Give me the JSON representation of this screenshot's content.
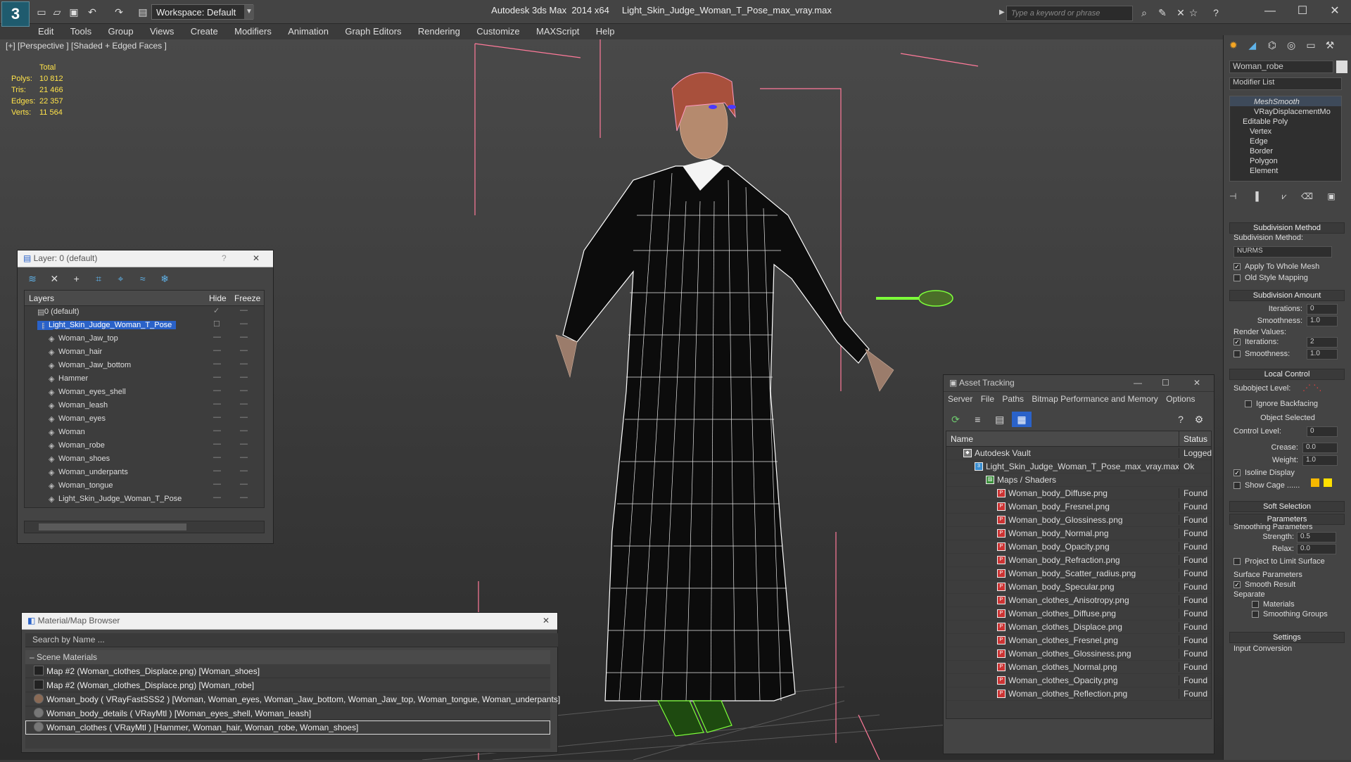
{
  "app": {
    "title": "Autodesk 3ds Max  2014 x64     Light_Skin_Judge_Woman_T_Pose_max_vray.max",
    "workspace": "Workspace: Default",
    "search_placeholder": "Type a keyword or phrase",
    "logo": "3"
  },
  "menus": [
    "Edit",
    "Tools",
    "Group",
    "Views",
    "Create",
    "Modifiers",
    "Animation",
    "Graph Editors",
    "Rendering",
    "Customize",
    "MAXScript",
    "Help"
  ],
  "viewport": {
    "label": "[+] [Perspective ] [Shaded + Edged Faces ]",
    "stats": {
      "header": "Total",
      "polys_label": "Polys:",
      "polys": "10 812",
      "tris_label": "Tris:",
      "tris": "21 466",
      "edges_label": "Edges:",
      "edges": "22 357",
      "verts_label": "Verts:",
      "verts": "11 564"
    }
  },
  "layer_panel": {
    "title": "Layer: 0 (default)",
    "help": "?",
    "close": "✕",
    "col_layers": "Layers",
    "col_hide": "Hide",
    "col_freeze": "Freeze",
    "rows": [
      {
        "name": "0 (default)",
        "indent": 1
      },
      {
        "name": "Light_Skin_Judge_Woman_T_Pose",
        "indent": 1,
        "selected": true
      },
      {
        "name": "Woman_Jaw_top",
        "indent": 2
      },
      {
        "name": "Woman_hair",
        "indent": 2
      },
      {
        "name": "Woman_Jaw_bottom",
        "indent": 2
      },
      {
        "name": "Hammer",
        "indent": 2
      },
      {
        "name": "Woman_eyes_shell",
        "indent": 2
      },
      {
        "name": "Woman_leash",
        "indent": 2
      },
      {
        "name": "Woman_eyes",
        "indent": 2
      },
      {
        "name": "Woman",
        "indent": 2
      },
      {
        "name": "Woman_robe",
        "indent": 2
      },
      {
        "name": "Woman_shoes",
        "indent": 2
      },
      {
        "name": "Woman_underpants",
        "indent": 2
      },
      {
        "name": "Woman_tongue",
        "indent": 2
      },
      {
        "name": "Light_Skin_Judge_Woman_T_Pose",
        "indent": 2
      }
    ]
  },
  "material_browser": {
    "title": "Material/Map Browser",
    "close": "✕",
    "search_placeholder": "Search by Name ...",
    "group": "Scene Materials",
    "rows": [
      "Map #2 (Woman_clothes_Displace.png) [Woman_shoes]",
      "Map #2 (Woman_clothes_Displace.png) [Woman_robe]",
      "Woman_body  ( VRayFastSSS2 ) [Woman, Woman_eyes, Woman_Jaw_bottom, Woman_Jaw_top, Woman_tongue, Woman_underpants]",
      "Woman_body_details  ( VRayMtl ) [Woman_eyes_shell, Woman_leash]",
      "Woman_clothes  ( VRayMtl ) [Hammer, Woman_hair, Woman_robe, Woman_shoes]"
    ]
  },
  "asset_tracking": {
    "title": "Asset Tracking",
    "menu": [
      "Server",
      "File",
      "Paths",
      "Bitmap Performance and Memory",
      "Options"
    ],
    "col_name": "Name",
    "col_status": "Status",
    "rows": [
      {
        "name": "Autodesk Vault",
        "status": "Logged O",
        "indent": 0
      },
      {
        "name": "Light_Skin_Judge_Woman_T_Pose_max_vray.max",
        "status": "Ok",
        "indent": 1
      },
      {
        "name": "Maps / Shaders",
        "status": "",
        "indent": 2
      },
      {
        "name": "Woman_body_Diffuse.png",
        "status": "Found",
        "indent": 3
      },
      {
        "name": "Woman_body_Fresnel.png",
        "status": "Found",
        "indent": 3
      },
      {
        "name": "Woman_body_Glossiness.png",
        "status": "Found",
        "indent": 3
      },
      {
        "name": "Woman_body_Normal.png",
        "status": "Found",
        "indent": 3
      },
      {
        "name": "Woman_body_Opacity.png",
        "status": "Found",
        "indent": 3
      },
      {
        "name": "Woman_body_Refraction.png",
        "status": "Found",
        "indent": 3
      },
      {
        "name": "Woman_body_Scatter_radius.png",
        "status": "Found",
        "indent": 3
      },
      {
        "name": "Woman_body_Specular.png",
        "status": "Found",
        "indent": 3
      },
      {
        "name": "Woman_clothes_Anisotropy.png",
        "status": "Found",
        "indent": 3
      },
      {
        "name": "Woman_clothes_Diffuse.png",
        "status": "Found",
        "indent": 3
      },
      {
        "name": "Woman_clothes_Displace.png",
        "status": "Found",
        "indent": 3
      },
      {
        "name": "Woman_clothes_Fresnel.png",
        "status": "Found",
        "indent": 3
      },
      {
        "name": "Woman_clothes_Glossiness.png",
        "status": "Found",
        "indent": 3
      },
      {
        "name": "Woman_clothes_Normal.png",
        "status": "Found",
        "indent": 3
      },
      {
        "name": "Woman_clothes_Opacity.png",
        "status": "Found",
        "indent": 3
      },
      {
        "name": "Woman_clothes_Reflection.png",
        "status": "Found",
        "indent": 3
      }
    ]
  },
  "command_panel": {
    "object_name": "Woman_robe",
    "modifier_list": "Modifier List",
    "stack": [
      "MeshSmooth",
      "VRayDisplacementMo",
      "Editable Poly",
      "Vertex",
      "Edge",
      "Border",
      "Polygon",
      "Element"
    ],
    "subdivision_method_title": "Subdivision Method",
    "subdivision_method_label": "Subdivision Method:",
    "subdivision_method_value": "NURMS",
    "apply_whole_mesh": "Apply To Whole Mesh",
    "old_style_mapping": "Old Style Mapping",
    "subdivision_amount_title": "Subdivision Amount",
    "iterations_label": "Iterations:",
    "iterations_value": "0",
    "smoothness_label": "Smoothness:",
    "smoothness_value": "1.0",
    "render_values_label": "Render Values:",
    "render_iterations_value": "2",
    "render_smoothness_value": "1.0",
    "local_control_title": "Local Control",
    "subobject_level_label": "Subobject Level:",
    "ignore_backfacing": "Ignore Backfacing",
    "object_selected": "Object Selected",
    "control_level_label": "Control Level:",
    "control_level_value": "0",
    "crease_label": "Crease:",
    "crease_value": "0.0",
    "weight_label": "Weight:",
    "weight_value": "1.0",
    "isoline_display": "Isoline Display",
    "show_cage": "Show Cage ......",
    "soft_selection_title": "Soft Selection",
    "parameters_title": "Parameters",
    "smoothing_parameters": "Smoothing Parameters",
    "strength_label": "Strength:",
    "strength_value": "0.5",
    "relax_label": "Relax:",
    "relax_value": "0.0",
    "project_limit": "Project to Limit Surface",
    "surface_parameters": "Surface Parameters",
    "smooth_result": "Smooth Result",
    "separate": "Separate",
    "materials": "Materials",
    "smoothing_groups": "Smoothing Groups",
    "settings_title": "Settings",
    "input_conversion": "Input Conversion"
  },
  "colors": {
    "accent": "#2a62c9",
    "stats": "#ffe34a",
    "wire": "#ffffff",
    "helper": "#ff7a9a",
    "selected_green": "#7dff3a"
  }
}
